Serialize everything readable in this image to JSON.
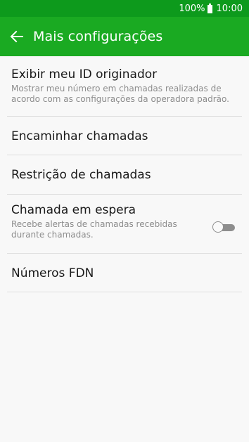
{
  "status_bar": {
    "battery": "100%",
    "time": "10:00"
  },
  "app_bar": {
    "title": "Mais configurações",
    "back_icon": "arrow-back-icon"
  },
  "settings": [
    {
      "title": "Exibir meu ID originador",
      "subtitle": "Mostrar meu número em chamadas realizadas de acordo com as configurações da operadora padrão."
    },
    {
      "title": "Encaminhar chamadas"
    },
    {
      "title": "Restrição de chamadas"
    },
    {
      "title": "Chamada em espera",
      "subtitle": "Recebe alertas de chamadas recebidas durante chamadas.",
      "toggle_on": false
    },
    {
      "title": "Números FDN"
    }
  ],
  "colors": {
    "status_bar": "#0d9a1c",
    "app_bar": "#1aaa22",
    "background": "#f8f8f8",
    "divider": "#dedede"
  }
}
